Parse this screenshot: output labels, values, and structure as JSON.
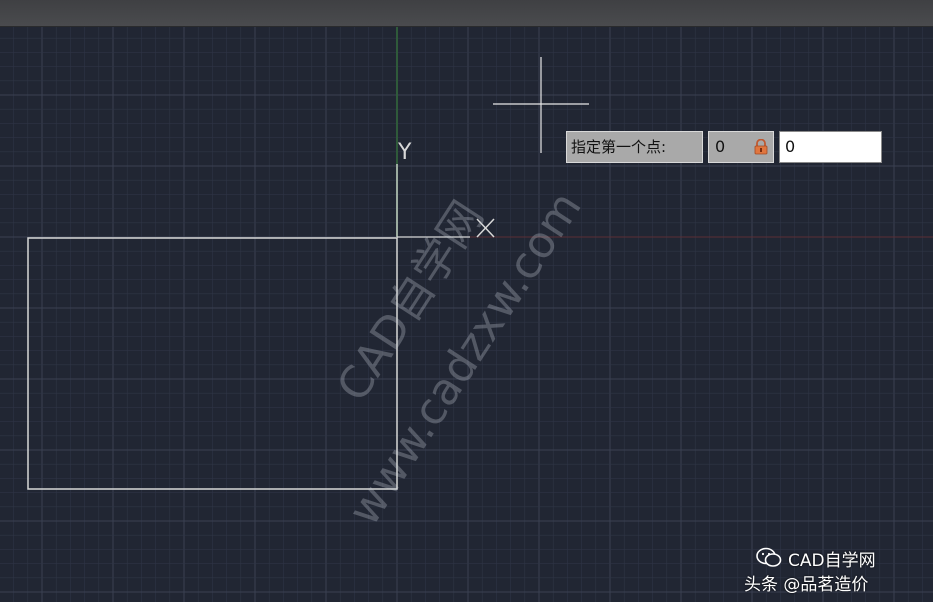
{
  "canvas": {
    "background": "#212633",
    "grid_color": "#2f3546",
    "major_grid_color": "#3a4052",
    "geometry_color": "#d8d8d8"
  },
  "ucs": {
    "y_label": "Y"
  },
  "dynamic_input": {
    "prompt": "指定第一个点:",
    "x_value": "0",
    "y_value": "0",
    "lock_icon": "lock-icon"
  },
  "watermark": {
    "logo_text": "CAD自学网",
    "url_text": "www.cadzxw.com"
  },
  "footer": {
    "icon": "wechat-icon",
    "brand": "CAD自学网",
    "source": "头条 @品茗造价"
  }
}
